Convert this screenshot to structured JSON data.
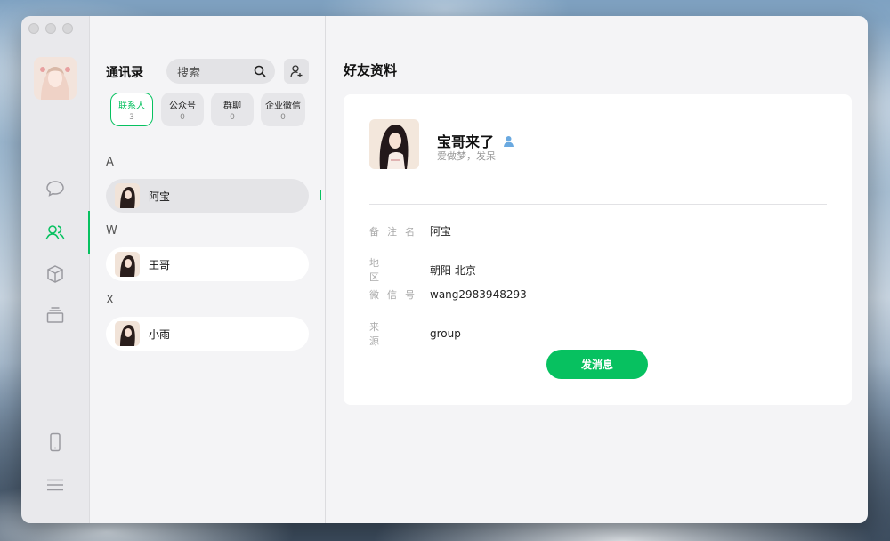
{
  "colors": {
    "accent": "#07c160",
    "sidebar_bg": "#e9e9ec",
    "panel_bg": "#f4f4f6",
    "card_bg": "#ffffff"
  },
  "nav": {
    "icons": [
      "chat-bubble-icon",
      "contacts-icon",
      "box-icon",
      "collections-icon",
      "phone-icon",
      "menu-icon"
    ],
    "active": "contacts-icon"
  },
  "contacts": {
    "title": "通讯录",
    "search_placeholder": "搜索",
    "categories": [
      {
        "label": "联系人",
        "count": "3"
      },
      {
        "label": "公众号",
        "count": "0"
      },
      {
        "label": "群聊",
        "count": "0"
      },
      {
        "label": "企业微信",
        "count": "0"
      }
    ],
    "groups": [
      {
        "letter": "A",
        "items": [
          {
            "name": "阿宝"
          }
        ]
      },
      {
        "letter": "W",
        "items": [
          {
            "name": "王哥"
          }
        ]
      },
      {
        "letter": "X",
        "items": [
          {
            "name": "小雨"
          }
        ]
      }
    ]
  },
  "detail": {
    "title": "好友资料",
    "name": "宝哥来了",
    "signature": "爱做梦，发呆",
    "fields": [
      {
        "label": "备注名",
        "value": "阿宝"
      },
      {
        "label": "地区",
        "value": "朝阳 北京"
      },
      {
        "label": "微信号",
        "value": "wang2983948293"
      },
      {
        "label": "来源",
        "value": "group"
      }
    ],
    "send_button": "发消息"
  }
}
